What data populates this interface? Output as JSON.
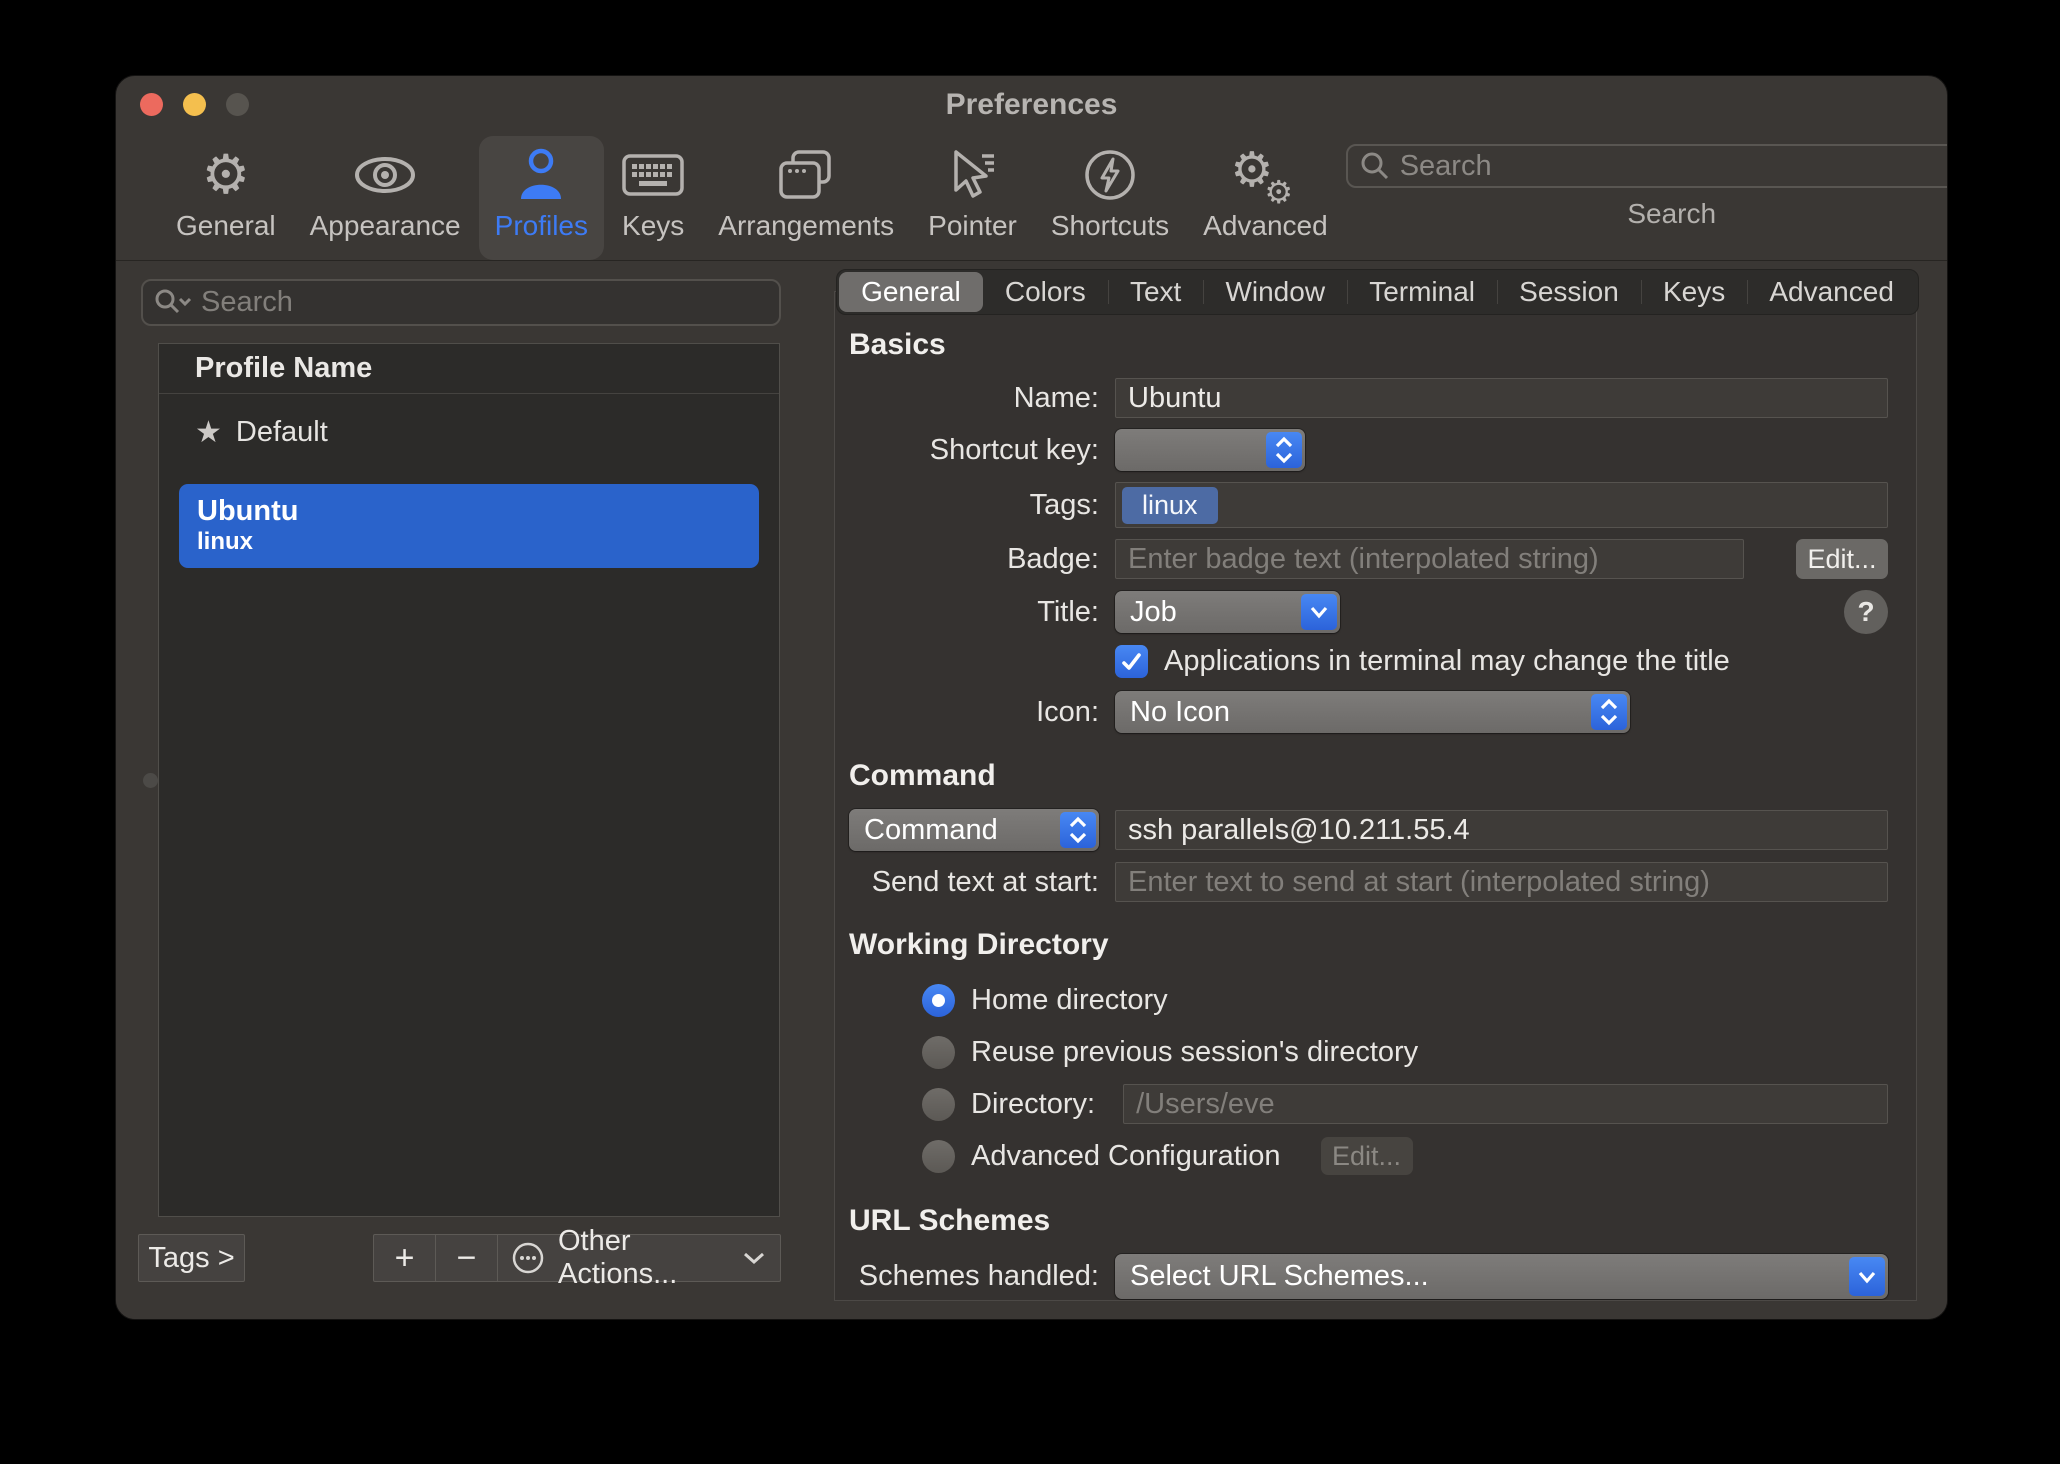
{
  "window": {
    "title": "Preferences"
  },
  "toolbar": {
    "items": [
      {
        "label": "General",
        "icon": "gear-icon"
      },
      {
        "label": "Appearance",
        "icon": "eye-icon"
      },
      {
        "label": "Profiles",
        "icon": "person-icon"
      },
      {
        "label": "Keys",
        "icon": "keyboard-icon"
      },
      {
        "label": "Arrangements",
        "icon": "windows-icon"
      },
      {
        "label": "Pointer",
        "icon": "cursor-icon"
      },
      {
        "label": "Shortcuts",
        "icon": "bolt-circle-icon"
      },
      {
        "label": "Advanced",
        "icon": "gears-icon"
      }
    ],
    "selected": "Profiles",
    "search": {
      "placeholder": "Search",
      "caption": "Search"
    }
  },
  "sidebar": {
    "search_placeholder": "Search",
    "list_header": "Profile Name",
    "profiles": [
      {
        "name": "Default",
        "starred": true,
        "selected": false
      },
      {
        "name": "Ubuntu",
        "tag": "linux",
        "selected": true
      }
    ],
    "tags_button": "Tags >",
    "add_label": "+",
    "remove_label": "−",
    "other_actions_label": "Other Actions..."
  },
  "tabs": {
    "items": [
      "General",
      "Colors",
      "Text",
      "Window",
      "Terminal",
      "Session",
      "Keys",
      "Advanced"
    ],
    "selected": "General"
  },
  "general": {
    "basics": {
      "header": "Basics",
      "name_label": "Name:",
      "name_value": "Ubuntu",
      "shortcut_label": "Shortcut key:",
      "shortcut_value": "",
      "tags_label": "Tags:",
      "tag": "linux",
      "badge_label": "Badge:",
      "badge_placeholder": "Enter badge text (interpolated string)",
      "badge_edit_button": "Edit...",
      "title_label": "Title:",
      "title_value": "Job",
      "help_button": "?",
      "title_checkbox_label": "Applications in terminal may change the title",
      "title_checkbox_checked": true,
      "icon_label": "Icon:",
      "icon_value": "No Icon"
    },
    "command": {
      "header": "Command",
      "type_value": "Command",
      "command_value": "ssh parallels@10.211.55.4",
      "send_text_label": "Send text at start:",
      "send_text_placeholder": "Enter text to send at start (interpolated string)"
    },
    "working_directory": {
      "header": "Working Directory",
      "options": [
        {
          "label": "Home directory",
          "selected": true
        },
        {
          "label": "Reuse previous session's directory",
          "selected": false
        },
        {
          "label": "Directory:",
          "selected": false
        },
        {
          "label": "Advanced Configuration",
          "selected": false
        }
      ],
      "directory_placeholder": "/Users/eve",
      "advanced_edit_button": "Edit..."
    },
    "url_schemes": {
      "header": "URL Schemes",
      "schemes_label": "Schemes handled:",
      "schemes_value": "Select URL Schemes..."
    }
  },
  "colors": {
    "accent_blue": "#3574e2",
    "popup_accent_blue": "#3b78ea",
    "selection_blue": "#2a63cb",
    "tag_blue": "#4d6ba4",
    "toolbar_selected_blue": "#3d7bf5"
  }
}
